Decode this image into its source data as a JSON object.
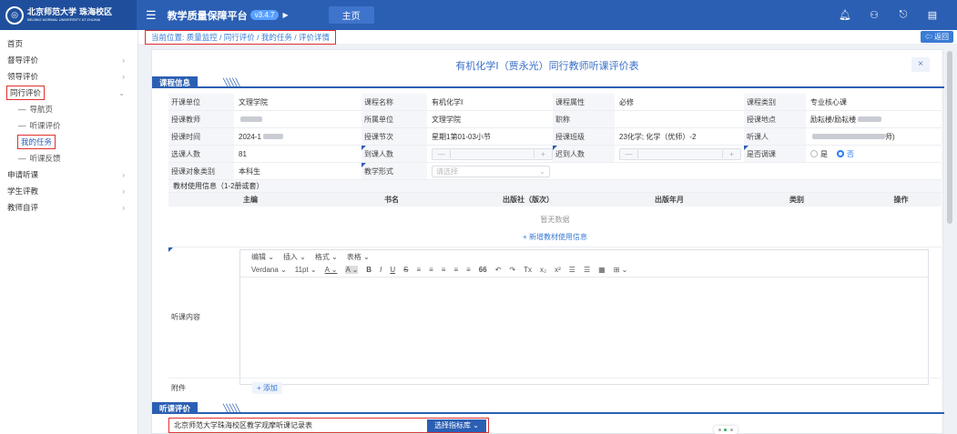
{
  "brand": {
    "logo_text": "北京师范大学 珠海校区",
    "subtitle": "BEIJING NORMAL UNIVERSITY AT ZHUHAI"
  },
  "header": {
    "title": "教学质量保障平台",
    "version": "v3.4.7",
    "home_tab": "主页",
    "icons": [
      "bell-icon",
      "user-icon",
      "logout-icon",
      "menu-icon"
    ]
  },
  "sidebar": {
    "items": [
      {
        "label": "首页",
        "chev": ""
      },
      {
        "label": "督导评价",
        "chev": "›"
      },
      {
        "label": "领导评价",
        "chev": "›"
      },
      {
        "label": "同行评价",
        "chev": "⌄"
      },
      {
        "label": "导航页",
        "chev": ""
      },
      {
        "label": "听课评价",
        "chev": ""
      },
      {
        "label": "我的任务",
        "chev": ""
      },
      {
        "label": "听课反馈",
        "chev": ""
      },
      {
        "label": "申请听课",
        "chev": "›"
      },
      {
        "label": "学生评教",
        "chev": "›"
      },
      {
        "label": "教师自评",
        "chev": "›"
      }
    ]
  },
  "breadcrumb": "当前位置: 质量监控 / 同行评价 / 我的任务 / 评价详情",
  "back_label": "返回",
  "form": {
    "title": "有机化学Ⅰ（贾永光）同行教师听课评价表",
    "close": "×",
    "section1": "课程信息",
    "labels": {
      "kkdw": "开课单位",
      "kcmc": "课程名称",
      "kcsx": "课程属性",
      "kclb": "课程类别",
      "skjs": "授课教师",
      "ssdw": "所属单位",
      "zc": "职称",
      "tkdd": "授课地点",
      "sksj": "授课时间",
      "skjc": "授课节次",
      "skbj": "授课班级",
      "tkr": "听课人",
      "xkrs": "选课人数",
      "ddrs": "到课人数",
      "cdrs": "迟到人数",
      "sfdk": "是否调课",
      "skdx": "授课对象类别",
      "jxxs": "教学形式"
    },
    "values": {
      "kkdw": "文理学院",
      "kcmc": "有机化学Ⅰ",
      "kcsx": "必修",
      "kclb": "专业核心课",
      "skjs": "",
      "ssdw": "文理学院",
      "zc": "",
      "tkdd": "励耘楼/励耘楼",
      "sksj": "2024-1",
      "skjc": "星期1第01-03小节",
      "skbj": "23化学; 化学（优师）-2",
      "tkr": "",
      "tkr_tail": "师)",
      "xkrs": "81",
      "skdx": "本科生",
      "jxxs_placeholder": "请选择"
    },
    "radio": {
      "yes": "是",
      "no": "否"
    },
    "materials": {
      "caption": "教材使用信息（1-2册或套）",
      "cols": [
        "主编",
        "书名",
        "出版社（版次）",
        "出版年月",
        "类别",
        "操作"
      ],
      "empty": "暂无数据",
      "add": "+ 新增教材使用信息"
    },
    "editor": {
      "label": "听课内容",
      "menu": [
        "编辑 ⌄",
        "插入 ⌄",
        "格式 ⌄",
        "表格 ⌄"
      ],
      "tools": [
        "Verdana ⌄",
        "11pt ⌄",
        "A ⌄",
        "A ⌄",
        "B",
        "I",
        "U",
        "S",
        "≡",
        "≡",
        "≡",
        "≡",
        "≡",
        "66",
        "↶",
        "↷",
        "Tx",
        "x₂",
        "x²",
        "☰",
        "☰",
        "▦",
        "⊞ ⌄"
      ]
    },
    "attach": {
      "label": "附件",
      "add": "+ 添加"
    },
    "section2": "听课评价",
    "library": {
      "name": "北京师范大学珠海校区教学观摩听课记录表",
      "button": "选择指标库 ⌄"
    }
  }
}
